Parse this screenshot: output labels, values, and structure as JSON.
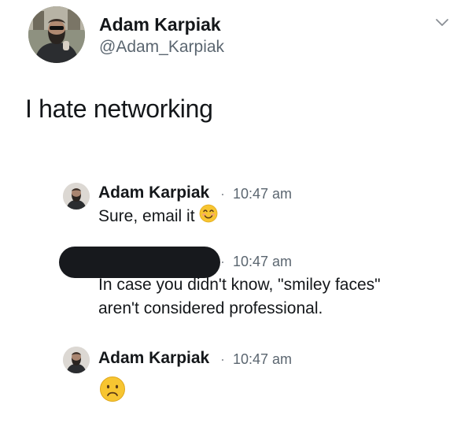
{
  "tweet": {
    "display_name": "Adam Karpiak",
    "handle": "@Adam_Karpiak",
    "text": "I hate networking",
    "menu_icon": "chevron-down-icon"
  },
  "messages": [
    {
      "name": "Adam Karpiak",
      "separator": "·",
      "time": "10:47 am",
      "text": "Sure, email it",
      "emoji": "smiling-face-icon"
    },
    {
      "name": "",
      "name_redacted": true,
      "separator": "·",
      "time": "10:47 am",
      "lines": [
        "In case you didn't know, \"smiley faces\"",
        "aren't considered professional."
      ]
    },
    {
      "name": "Adam Karpiak",
      "separator": "·",
      "time": "10:47 am",
      "emoji": "frowning-face-icon"
    }
  ],
  "colors": {
    "text": "#14171a",
    "secondary": "#5b6670",
    "emoji_yellow": "#f7c531",
    "redaction": "#17191d"
  }
}
